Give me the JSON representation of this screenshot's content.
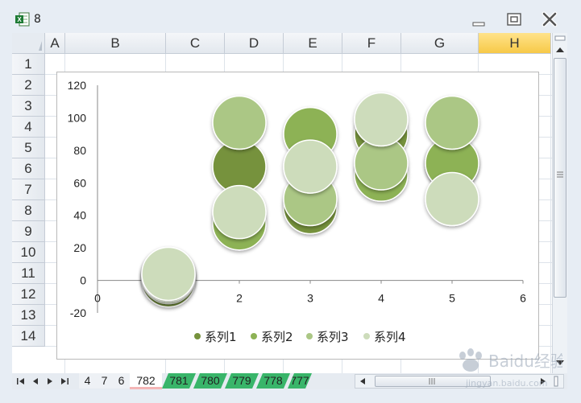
{
  "window": {
    "title": "8",
    "minimize_icon": "minimize-icon",
    "restore_icon": "restore-icon",
    "close_icon": "close-icon"
  },
  "columns": [
    "A",
    "B",
    "C",
    "D",
    "E",
    "F",
    "G",
    "H"
  ],
  "selected_column": "H",
  "rows": [
    "1",
    "2",
    "3",
    "4",
    "5",
    "6",
    "7",
    "8",
    "9",
    "10",
    "11",
    "12",
    "13",
    "14"
  ],
  "sheet_tabs": [
    "4",
    "7",
    "6",
    "782",
    "781",
    "780",
    "779",
    "778",
    "777"
  ],
  "active_tab": "782",
  "tab_colors": {
    "782": "#f4b6b6",
    "781": "#39b56a",
    "780": "#39b56a",
    "779": "#39b56a",
    "778": "#39b56a",
    "777": "#39b56a"
  },
  "watermark": {
    "text": "Baidu经验",
    "subtext": "jingyan.baidu.com"
  },
  "chart_data": {
    "type": "scatter",
    "subtype": "bubble",
    "xlim": [
      0,
      6
    ],
    "ylim": [
      -20,
      120
    ],
    "x_ticks": [
      "0",
      "1",
      "2",
      "3",
      "4",
      "5",
      "6"
    ],
    "y_ticks": [
      "120",
      "100",
      "80",
      "60",
      "40",
      "20",
      "0",
      "-20"
    ],
    "legend_position": "bottom",
    "grid": false,
    "series": [
      {
        "name": "系列1",
        "color": "#76923c",
        "points": [
          [
            1,
            0
          ],
          [
            2,
            70
          ],
          [
            3,
            45
          ],
          [
            4,
            90
          ],
          [
            5,
            72
          ]
        ]
      },
      {
        "name": "系列2",
        "color": "#8db255",
        "points": [
          [
            1,
            2
          ],
          [
            2,
            35
          ],
          [
            3,
            90
          ],
          [
            4,
            65
          ],
          [
            5,
            72
          ]
        ]
      },
      {
        "name": "系列3",
        "color": "#abc785",
        "points": [
          [
            1,
            3
          ],
          [
            2,
            97
          ],
          [
            3,
            50
          ],
          [
            4,
            72
          ],
          [
            5,
            97
          ]
        ]
      },
      {
        "name": "系列4",
        "color": "#cddcbb",
        "points": [
          [
            1,
            4
          ],
          [
            2,
            42
          ],
          [
            3,
            70
          ],
          [
            4,
            99
          ],
          [
            5,
            50
          ]
        ]
      }
    ]
  }
}
